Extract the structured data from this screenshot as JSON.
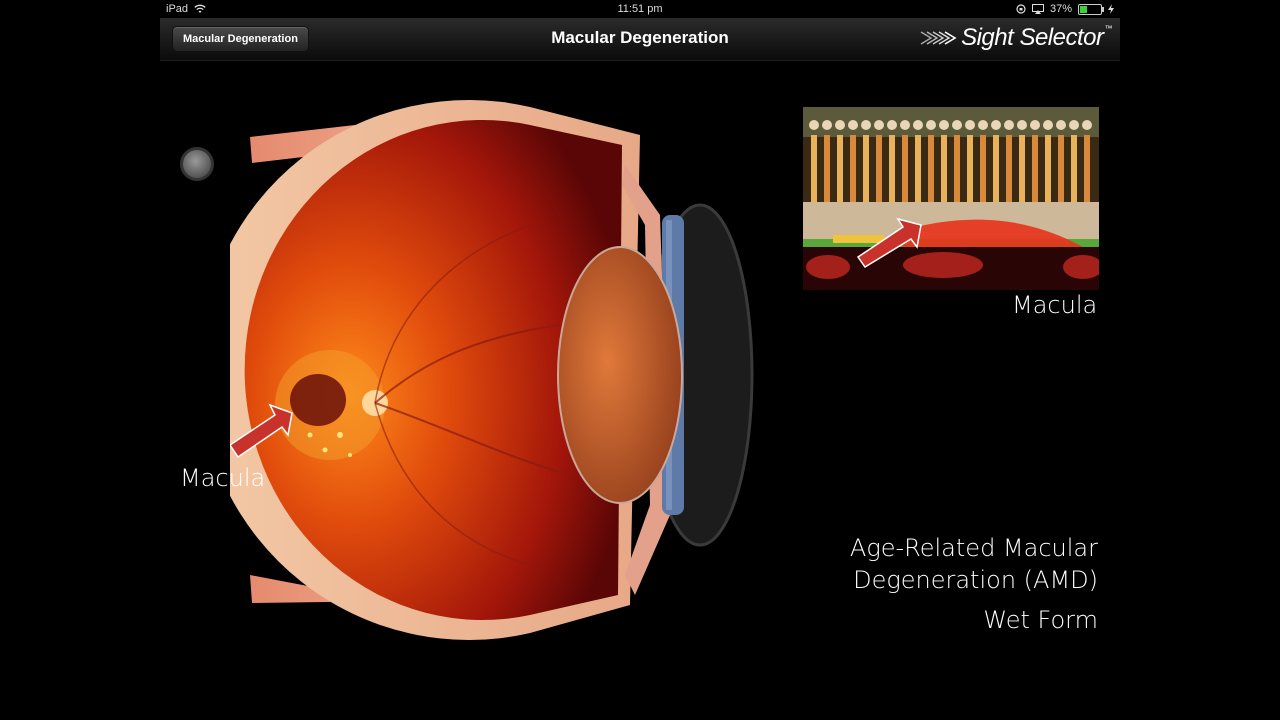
{
  "status_bar": {
    "device": "iPad",
    "time": "11:51 pm",
    "battery": "37%",
    "battery_fraction": 0.37
  },
  "nav": {
    "back_label": "Macular Degeneration",
    "title": "Macular Degeneration",
    "brand": "Sight Selector",
    "brand_mark": "™"
  },
  "diagram": {
    "eye_label": "Macula",
    "inset_label": "Macula",
    "caption_line1": "Age-Related Macular",
    "caption_line2": "Degeneration (AMD)",
    "caption_line3": "Wet Form"
  },
  "colors": {
    "background": "#000000",
    "retina": "#d0300a",
    "accent_arrow": "#c8322a",
    "battery": "#3dd13d"
  }
}
